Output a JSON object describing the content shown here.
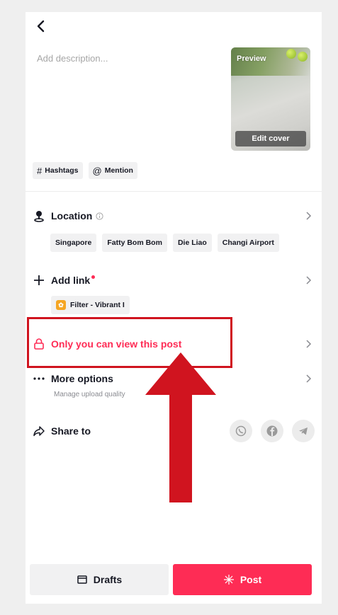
{
  "header": {
    "back_icon": "chevron-left-icon"
  },
  "description": {
    "placeholder": "Add description..."
  },
  "cover": {
    "preview_label": "Preview",
    "edit_label": "Edit cover"
  },
  "tags": [
    {
      "icon": "#",
      "label": "Hashtags"
    },
    {
      "icon": "@",
      "label": "Mention"
    }
  ],
  "location": {
    "label": "Location",
    "suggestions": [
      "Singapore",
      "Fatty Bom Bom",
      "Die Liao",
      "Changi Airport"
    ]
  },
  "add_link": {
    "label": "Add link",
    "chip": "Filter - Vibrant I"
  },
  "privacy": {
    "label": "Only you can view this post",
    "color": "#fe2c55"
  },
  "more_options": {
    "label": "More options",
    "subtitle": "Manage upload quality"
  },
  "share": {
    "label": "Share to",
    "targets": [
      "whatsapp-icon",
      "facebook-icon",
      "telegram-icon"
    ]
  },
  "footer": {
    "drafts_label": "Drafts",
    "post_label": "Post"
  },
  "colors": {
    "accent": "#fe2c55",
    "annotation": "#d0141f"
  }
}
